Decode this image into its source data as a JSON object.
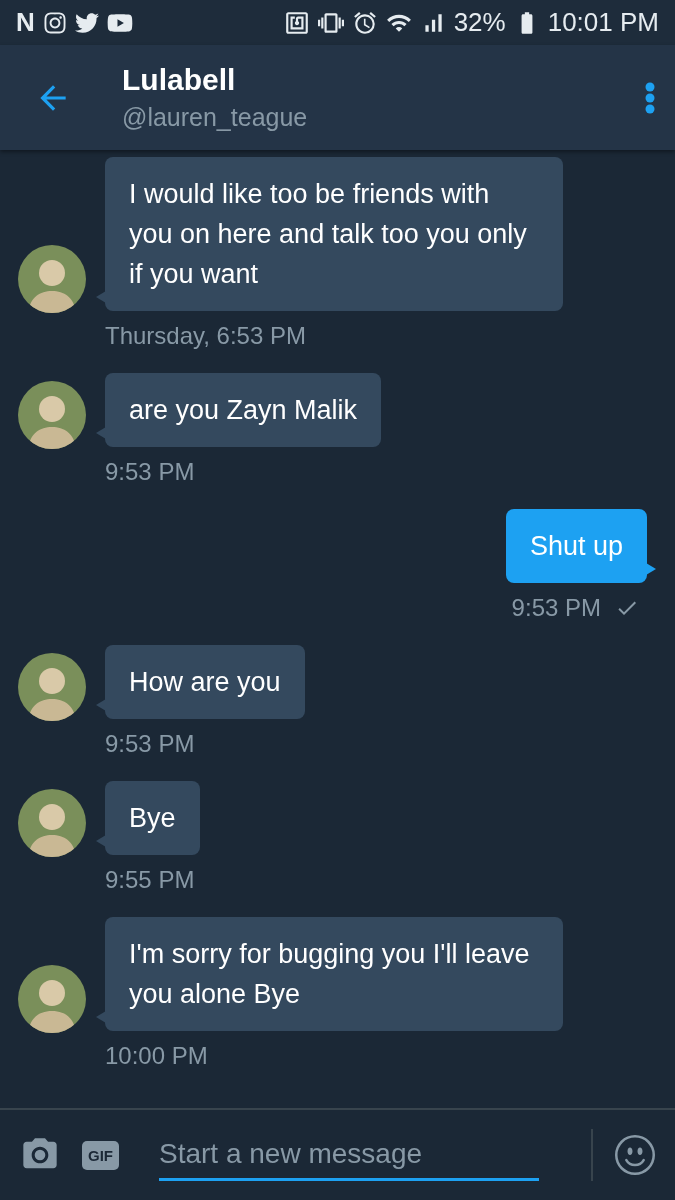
{
  "status_bar": {
    "left_text": "N",
    "battery": "32%",
    "time": "10:01 PM"
  },
  "header": {
    "name": "Lulabell",
    "handle": "@lauren_teague"
  },
  "messages": [
    {
      "kind": "received",
      "text": "I would like too be friends with you on here and talk too you only if you want",
      "time": "Thursday, 6:53 PM"
    },
    {
      "kind": "received",
      "text": "are you Zayn Malik",
      "time": "9:53 PM"
    },
    {
      "kind": "sent",
      "text": "Shut up",
      "time": "9:53 PM",
      "read": true
    },
    {
      "kind": "received",
      "text": "How are you",
      "time": "9:53 PM"
    },
    {
      "kind": "received",
      "text": "Bye",
      "time": "9:55 PM"
    },
    {
      "kind": "received",
      "text": "I'm sorry for bugging you I'll leave you alone Bye",
      "time": "10:00 PM"
    }
  ],
  "composer": {
    "gif": "GIF",
    "placeholder": "Start a new message"
  }
}
